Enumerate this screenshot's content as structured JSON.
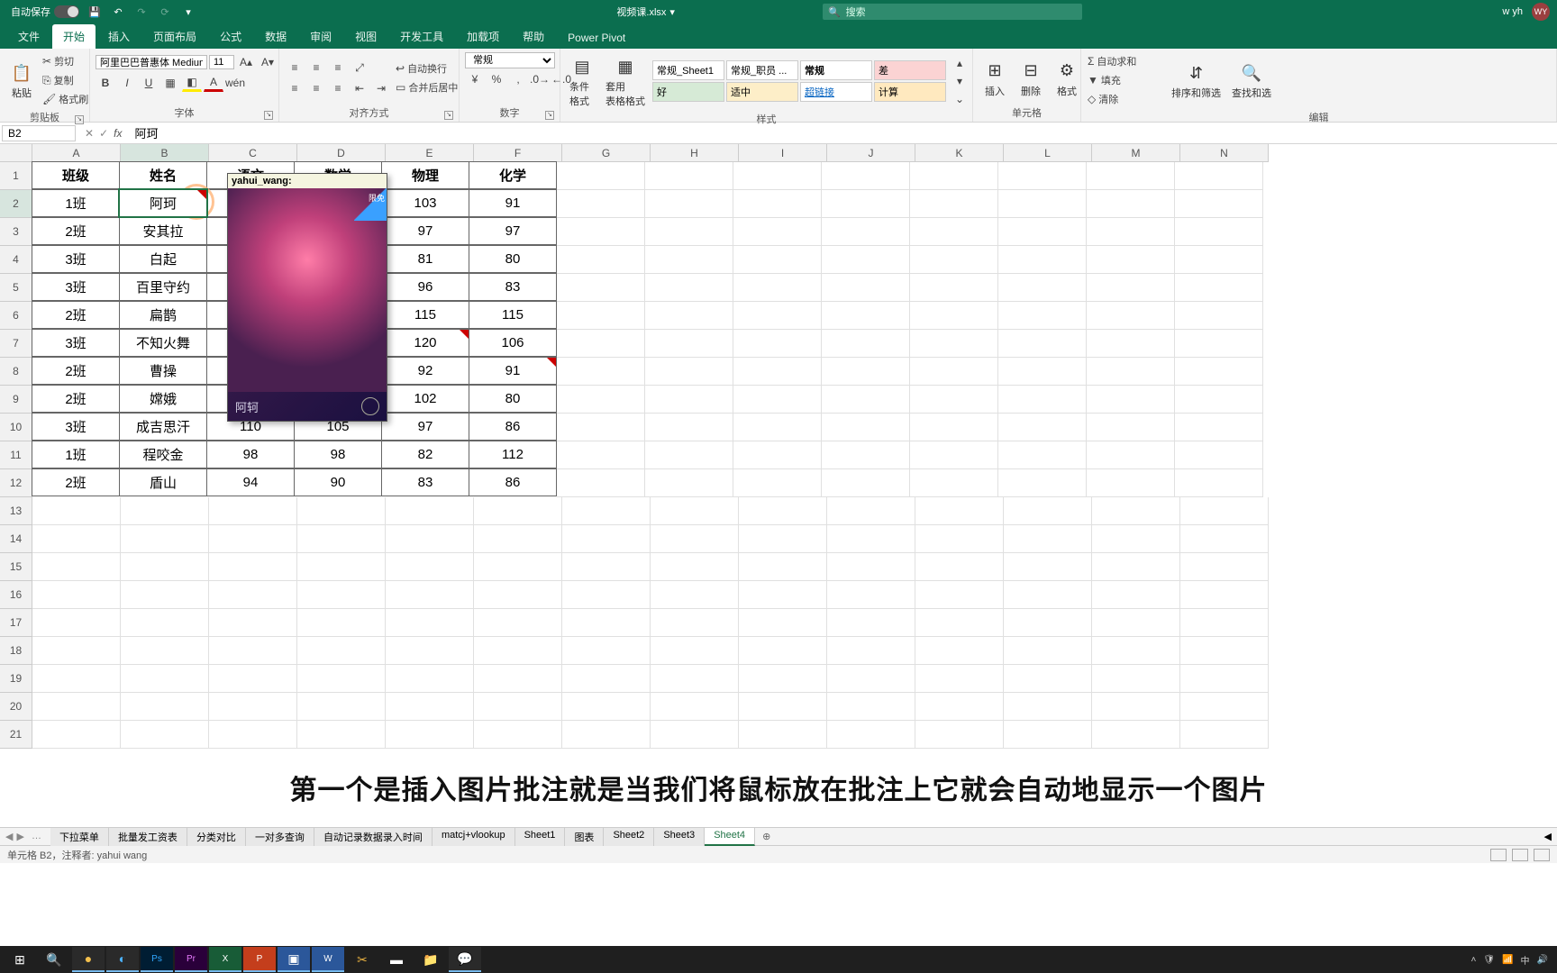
{
  "titlebar": {
    "autosave": "自动保存",
    "filename": "视频课.xlsx",
    "search_placeholder": "搜索",
    "user_label": "w yh",
    "user_initials": "WY"
  },
  "tabs": [
    "文件",
    "开始",
    "插入",
    "页面布局",
    "公式",
    "数据",
    "审阅",
    "视图",
    "开发工具",
    "加载项",
    "帮助",
    "Power Pivot"
  ],
  "active_tab": 1,
  "ribbon": {
    "clipboard": {
      "label": "剪贴板",
      "paste": "粘贴",
      "cut": "剪切",
      "copy": "复制",
      "painter": "格式刷"
    },
    "font": {
      "label": "字体",
      "name": "阿里巴巴普惠体 Medium",
      "size": "11"
    },
    "align": {
      "label": "对齐方式",
      "wrap": "自动换行",
      "merge": "合并后居中"
    },
    "number": {
      "label": "数字",
      "format": "常规"
    },
    "styles": {
      "label": "样式",
      "cond": "条件格式",
      "table": "套用\n表格格式",
      "gallery": [
        {
          "t": "常规_Sheet1",
          "bg": "#fff"
        },
        {
          "t": "常规_职员 ...",
          "bg": "#fff"
        },
        {
          "t": "常规",
          "bg": "#fff",
          "bold": true
        },
        {
          "t": "差",
          "bg": "#fbd3d3"
        },
        {
          "t": "好",
          "bg": "#d6ead6"
        },
        {
          "t": "适中",
          "bg": "#fdeec8"
        },
        {
          "t": "超链接",
          "bg": "#fff",
          "color": "#0563c1",
          "underline": true
        },
        {
          "t": "计算",
          "bg": "#ffe9bf"
        }
      ]
    },
    "cells": {
      "label": "单元格",
      "insert": "插入",
      "delete": "删除",
      "format": "格式"
    },
    "editing": {
      "label": "编辑",
      "sum": "自动求和",
      "fill": "填充",
      "clear": "清除",
      "sort": "排序和筛选",
      "find": "查找和选"
    }
  },
  "name_box": "B2",
  "formula_value": "阿珂",
  "columns": [
    "A",
    "B",
    "C",
    "D",
    "E",
    "F",
    "G",
    "H",
    "I",
    "J",
    "K",
    "L",
    "M",
    "N"
  ],
  "row_count": 21,
  "table": {
    "headers": [
      "班级",
      "姓名",
      "语文",
      "数学",
      "物理",
      "化学"
    ],
    "rows": [
      [
        "1班",
        "阿珂",
        "",
        "",
        "103",
        "91"
      ],
      [
        "2班",
        "安其拉",
        "",
        "",
        "97",
        "97"
      ],
      [
        "3班",
        "白起",
        "",
        "",
        "81",
        "80"
      ],
      [
        "3班",
        "百里守约",
        "",
        "",
        "96",
        "83"
      ],
      [
        "2班",
        "扁鹊",
        "",
        "",
        "115",
        "115"
      ],
      [
        "3班",
        "不知火舞",
        "",
        "",
        "120",
        "106"
      ],
      [
        "2班",
        "曹操",
        "",
        "",
        "92",
        "91"
      ],
      [
        "2班",
        "嫦娥",
        "",
        "",
        "102",
        "80"
      ],
      [
        "3班",
        "成吉思汗",
        "110",
        "105",
        "97",
        "86"
      ],
      [
        "1班",
        "程咬金",
        "98",
        "98",
        "82",
        "112"
      ],
      [
        "2班",
        "盾山",
        "94",
        "90",
        "83",
        "86"
      ]
    ]
  },
  "comment_triangles": [
    "B2",
    "E7",
    "F8"
  ],
  "comment_popup": {
    "author": "yahui_wang:",
    "badge": "限免",
    "charname": "阿轲"
  },
  "subtitle": "第一个是插入图片批注就是当我们将鼠标放在批注上它就会自动地显示一个图片",
  "sheet_tabs": [
    "下拉菜单",
    "批量发工资表",
    "分类对比",
    "一对多查询",
    "自动记录数据录入时间",
    "matcj+vlookup",
    "Sheet1",
    "图表",
    "Sheet2",
    "Sheet3",
    "Sheet4"
  ],
  "active_sheet": 10,
  "statusbar_left": "单元格 B2，注释者: yahui wang"
}
